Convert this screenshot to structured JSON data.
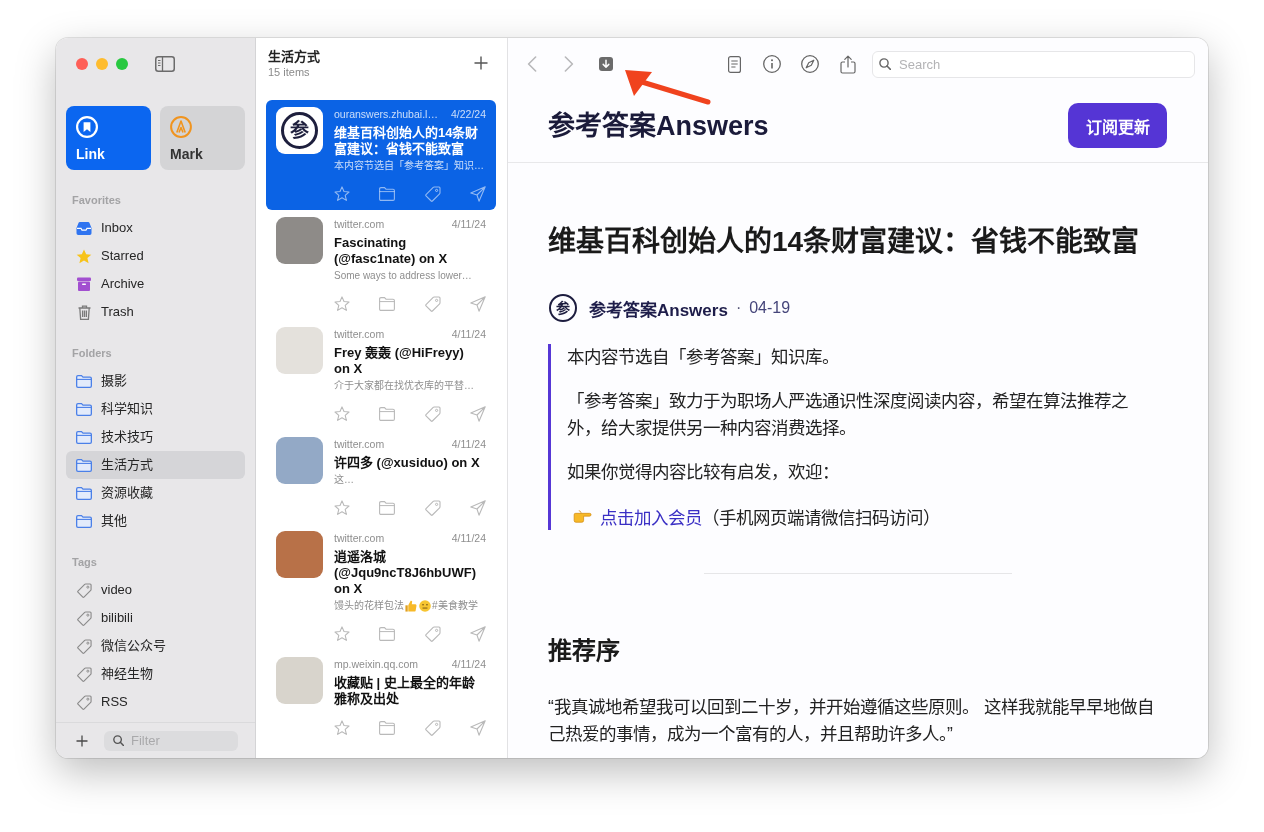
{
  "sidebar": {
    "modes": [
      {
        "kind": "link",
        "label": "Link",
        "selected": true
      },
      {
        "kind": "mark",
        "label": "Mark",
        "selected": false
      }
    ],
    "sections": [
      {
        "title": "Favorites",
        "items": [
          {
            "kind": "inbox",
            "label": "Inbox",
            "selected": false
          },
          {
            "kind": "starred",
            "label": "Starred",
            "selected": false
          },
          {
            "kind": "archive",
            "label": "Archive",
            "selected": false
          },
          {
            "kind": "trash",
            "label": "Trash",
            "selected": false
          }
        ]
      },
      {
        "title": "Folders",
        "items": [
          {
            "kind": "folder",
            "label": "摄影",
            "selected": false
          },
          {
            "kind": "folder",
            "label": "科学知识",
            "selected": false
          },
          {
            "kind": "folder",
            "label": "技术技巧",
            "selected": false
          },
          {
            "kind": "folder",
            "label": "生活方式",
            "selected": true
          },
          {
            "kind": "folder",
            "label": "资源收藏",
            "selected": false
          },
          {
            "kind": "folder",
            "label": "其他",
            "selected": false
          }
        ]
      },
      {
        "title": "Tags",
        "items": [
          {
            "kind": "tag",
            "label": "video",
            "selected": false
          },
          {
            "kind": "tag",
            "label": "bilibili",
            "selected": false
          },
          {
            "kind": "tag",
            "label": "微信公众号",
            "selected": false
          },
          {
            "kind": "tag",
            "label": "神经生物",
            "selected": false
          },
          {
            "kind": "tag",
            "label": "RSS",
            "selected": false
          }
        ]
      }
    ],
    "filter": {
      "placeholder": "Filter"
    }
  },
  "list": {
    "title": "生活方式",
    "count": "15 items",
    "items": [
      {
        "source": "ouranswers.zhubai.l…",
        "date": "4/22/24",
        "title": "维基百科创始人的14条财富建议：省钱不能致富",
        "excerpt": "本内容节选自「参考答案」知识…",
        "thumb": {
          "kind": "logo",
          "text": "参"
        },
        "selected": true
      },
      {
        "source": "twitter.com",
        "date": "4/11/24",
        "title": "Fascinating (@fasc1nate) on X",
        "excerpt": "Some ways to address lower…",
        "thumb": {
          "kind": "photo"
        },
        "selected": false
      },
      {
        "source": "twitter.com",
        "date": "4/11/24",
        "title": "Frey 轰轰 (@HiFreyy) on X",
        "excerpt": "介于大家都在找优衣库的平替…",
        "thumb": {
          "kind": "photo"
        },
        "selected": false
      },
      {
        "source": "twitter.com",
        "date": "4/11/24",
        "title": "许四多 (@xusiduo) on X",
        "excerpt": "这…",
        "thumb": {
          "kind": "photo"
        },
        "selected": false
      },
      {
        "source": "twitter.com",
        "date": "4/11/24",
        "title": "逍遥洛城 (@Jqu9ncT8J6hbUWF) on X",
        "excerpt_parts": [
          {
            "kind": "text",
            "text": "馒头的花样包法"
          },
          {
            "kind": "thumbs_up"
          },
          {
            "kind": "face"
          },
          {
            "kind": "text",
            "text": "#美食教学"
          }
        ],
        "thumb": {
          "kind": "photo"
        },
        "selected": false
      },
      {
        "source": "mp.weixin.qq.com",
        "date": "4/11/24",
        "title": "收藏贴 | 史上最全的年龄雅称及出处",
        "thumb": {
          "kind": "photo"
        },
        "selected": false
      }
    ]
  },
  "toolbar": {
    "nav": [
      {
        "kind": "back",
        "disabled": true
      },
      {
        "kind": "forward",
        "disabled": true
      }
    ],
    "search": {
      "placeholder": "Search"
    }
  },
  "reader": {
    "site": "参考答案Answers",
    "subscribe": "订阅更新",
    "title": "维基百科创始人的14条财富建议：省钱不能致富",
    "byline": {
      "avatar_text": "参",
      "author": "参考答案Answers",
      "separator": "·",
      "date": "04-19"
    },
    "quote": {
      "paragraphs": [
        "本内容节选自「参考答案」知识库。",
        "「参考答案」致力于为职场人严选通识性深度阅读内容，希望在算法推荐之外，给大家提供另一种内容消费选择。",
        "如果你觉得内容比较有启发，欢迎："
      ],
      "link": {
        "text": "点击加入会员",
        "note": "（手机网页端请微信扫码访问）"
      }
    },
    "section_heading": "推荐序",
    "paragraph": "“我真诚地希望我可以回到二十岁，并开始遵循这些原则。 这样我就能早早地做自己热爱的事情，成为一个富有的人，并且帮助许多人。”"
  }
}
